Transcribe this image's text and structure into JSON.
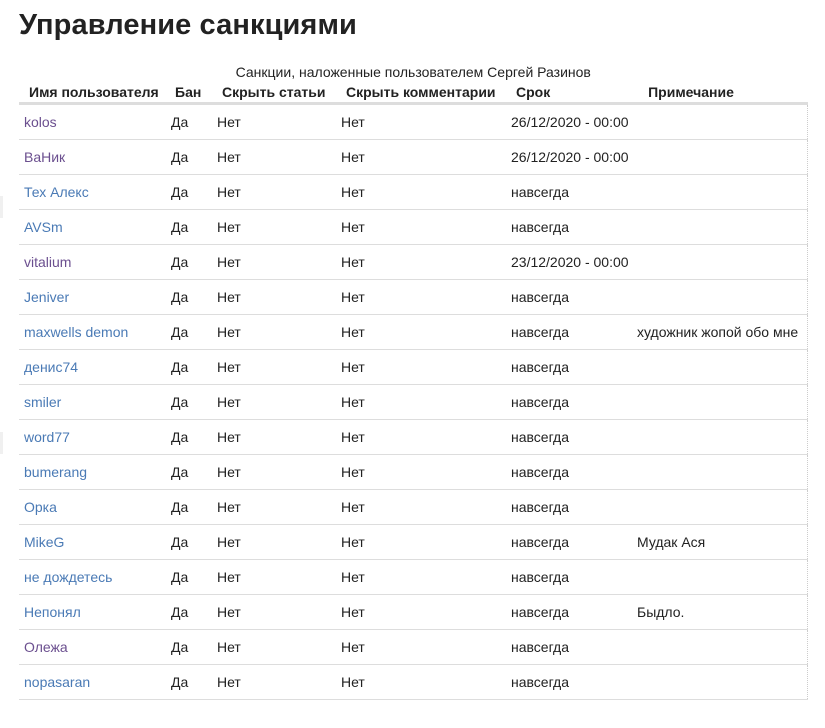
{
  "page": {
    "title": "Управление санкциями"
  },
  "table": {
    "caption": "Санкции, наложенные пользователем Сергей Разинов",
    "headers": {
      "name": "Имя пользователя",
      "ban": "Бан",
      "hide_posts": "Скрыть статьи",
      "hide_comments": "Скрыть комментарии",
      "term": "Срок",
      "note": "Примечание"
    },
    "rows": [
      {
        "user": "kolos",
        "visited": true,
        "ban": "Да",
        "hide_posts": "Нет",
        "hide_comments": "Нет",
        "term": "26/12/2020 - 00:00",
        "note": ""
      },
      {
        "user": "ВаНик",
        "visited": true,
        "ban": "Да",
        "hide_posts": "Нет",
        "hide_comments": "Нет",
        "term": "26/12/2020 - 00:00",
        "note": ""
      },
      {
        "user": "Тех Алекс",
        "visited": false,
        "ban": "Да",
        "hide_posts": "Нет",
        "hide_comments": "Нет",
        "term": "навсегда",
        "note": ""
      },
      {
        "user": "AVSm",
        "visited": false,
        "ban": "Да",
        "hide_posts": "Нет",
        "hide_comments": "Нет",
        "term": "навсегда",
        "note": ""
      },
      {
        "user": "vitalium",
        "visited": true,
        "ban": "Да",
        "hide_posts": "Нет",
        "hide_comments": "Нет",
        "term": "23/12/2020 - 00:00",
        "note": ""
      },
      {
        "user": "Jeniver",
        "visited": false,
        "ban": "Да",
        "hide_posts": "Нет",
        "hide_comments": "Нет",
        "term": "навсегда",
        "note": ""
      },
      {
        "user": "maxwells demon",
        "visited": false,
        "ban": "Да",
        "hide_posts": "Нет",
        "hide_comments": "Нет",
        "term": "навсегда",
        "note": "художник жопой обо мне"
      },
      {
        "user": "денис74",
        "visited": false,
        "ban": "Да",
        "hide_posts": "Нет",
        "hide_comments": "Нет",
        "term": "навсегда",
        "note": ""
      },
      {
        "user": "smiler",
        "visited": false,
        "ban": "Да",
        "hide_posts": "Нет",
        "hide_comments": "Нет",
        "term": "навсегда",
        "note": ""
      },
      {
        "user": "word77",
        "visited": false,
        "ban": "Да",
        "hide_posts": "Нет",
        "hide_comments": "Нет",
        "term": "навсегда",
        "note": ""
      },
      {
        "user": "bumerang",
        "visited": false,
        "ban": "Да",
        "hide_posts": "Нет",
        "hide_comments": "Нет",
        "term": "навсегда",
        "note": ""
      },
      {
        "user": "Орка",
        "visited": false,
        "ban": "Да",
        "hide_posts": "Нет",
        "hide_comments": "Нет",
        "term": "навсегда",
        "note": ""
      },
      {
        "user": "MikeG",
        "visited": false,
        "ban": "Да",
        "hide_posts": "Нет",
        "hide_comments": "Нет",
        "term": "навсегда",
        "note": "Мудак Ася"
      },
      {
        "user": "не дождетесь",
        "visited": false,
        "ban": "Да",
        "hide_posts": "Нет",
        "hide_comments": "Нет",
        "term": "навсегда",
        "note": ""
      },
      {
        "user": "Непонял",
        "visited": false,
        "ban": "Да",
        "hide_posts": "Нет",
        "hide_comments": "Нет",
        "term": "навсегда",
        "note": "Быдло."
      },
      {
        "user": "Олежа",
        "visited": true,
        "ban": "Да",
        "hide_posts": "Нет",
        "hide_comments": "Нет",
        "term": "навсегда",
        "note": ""
      },
      {
        "user": "nopasaran",
        "visited": false,
        "ban": "Да",
        "hide_posts": "Нет",
        "hide_comments": "Нет",
        "term": "навсегда",
        "note": ""
      }
    ]
  },
  "colors": {
    "link": "#4a7ab5",
    "link_visited": "#6b4f8f",
    "text": "#222222",
    "row_border": "#dddddd"
  }
}
